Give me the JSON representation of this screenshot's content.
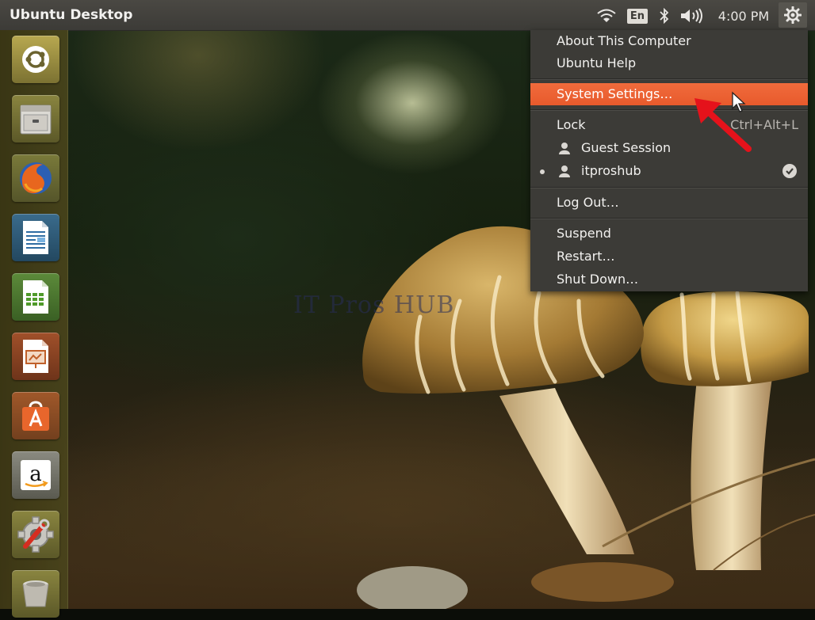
{
  "panel": {
    "title": "Ubuntu Desktop",
    "language": "En",
    "time": "4:00 PM"
  },
  "menu": {
    "items": [
      {
        "label": "About This Computer"
      },
      {
        "label": "Ubuntu Help"
      },
      {
        "label": "System Settings…",
        "highlighted": true
      },
      {
        "label": "Lock",
        "shortcut": "Ctrl+Alt+L"
      },
      {
        "label": "Guest Session"
      },
      {
        "label": "itproshub",
        "active": true
      },
      {
        "label": "Log Out…"
      },
      {
        "label": "Suspend"
      },
      {
        "label": "Restart…"
      },
      {
        "label": "Shut Down…"
      }
    ]
  },
  "launcher": {
    "items": [
      {
        "name": "dash-home-icon"
      },
      {
        "name": "files-icon"
      },
      {
        "name": "firefox-icon"
      },
      {
        "name": "libreoffice-writer-icon"
      },
      {
        "name": "libreoffice-calc-icon"
      },
      {
        "name": "libreoffice-impress-icon"
      },
      {
        "name": "software-center-icon"
      },
      {
        "name": "amazon-icon"
      },
      {
        "name": "system-settings-icon"
      },
      {
        "name": "trash-icon"
      }
    ]
  },
  "wallpaper": {
    "watermark": "IT Pros HUB"
  },
  "colors": {
    "panel": "#3c3b37",
    "highlight": "#e95a2c",
    "annotation_arrow": "#e5121b"
  }
}
